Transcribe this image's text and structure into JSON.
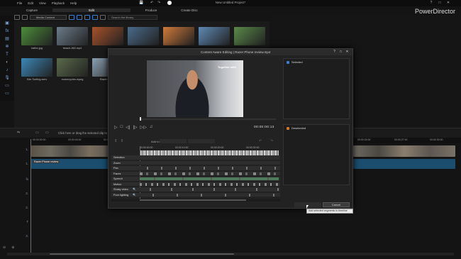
{
  "menu": {
    "items": [
      "File",
      "Edit",
      "View",
      "Playback",
      "Help"
    ]
  },
  "title": "New Untitled Project*",
  "window_controls": [
    "?",
    "—",
    "□",
    "✕"
  ],
  "mode_tabs": [
    {
      "label": "Capture"
    },
    {
      "label": "Edit",
      "active": true
    },
    {
      "label": "Produce"
    },
    {
      "label": "Create Disc"
    }
  ],
  "brand": "PowerDirector",
  "media_toolbar": {
    "select_value": "Media Content",
    "search_placeholder": "Search the library"
  },
  "media_items": [
    {
      "name": "bafbn.jpg",
      "color": "#4c8e3a"
    },
    {
      "name": "beach-360.mp4",
      "color": "#6b7c8a"
    },
    {
      "name": "",
      "color": "#a7522a"
    },
    {
      "name": "",
      "color": "#4a6a8a"
    },
    {
      "name": "",
      "color": "#d07a3a"
    },
    {
      "name": "",
      "color": "#5f89b4"
    },
    {
      "name": "",
      "color": "#5a8a4a"
    },
    {
      "name": "Kite Surfing.wmv",
      "color": "#3c88b8"
    },
    {
      "name": "motorcycles.mpeg",
      "color": "#5a6a4a"
    },
    {
      "name": "Razer Phone",
      "color": "#8aa0b0"
    }
  ],
  "timeline": {
    "hint": "Click here or drag the selected clip to a",
    "ruler": [
      "00:00:00:00",
      "00:00:03:00",
      "00:00:06:00",
      "00:00:09:00",
      "00:00:12:00",
      "00:00:15:00",
      "00:00:18:00",
      "00:00:21:00",
      "00:00:24:00",
      "00:00:27:00",
      "00:00:30:00",
      "00:00:33:00"
    ],
    "audio_clip_label": "Razer Phone review",
    "tracks": [
      "1.",
      "1.",
      "fx",
      "2.",
      "2.",
      "T",
      "3."
    ]
  },
  "dialog": {
    "title": "Content Aware Editing  |  Razer Phone review.mp4",
    "overlay_text": "Together with",
    "timecode": "00:00:00:13",
    "add_to_label": "Add to:",
    "ruler": [
      "00:00:00:00",
      "00:00:10:00",
      "00:00:20:00",
      "00:00:30:00"
    ],
    "rows": [
      {
        "label": "Selection",
        "color": "#3a3a3a"
      },
      {
        "label": "Zoom",
        "color": "#7a7a7a"
      },
      {
        "label": "Pan",
        "color": "#7a7a7a"
      },
      {
        "label": "Faces",
        "color": "#888"
      },
      {
        "label": "Speech",
        "color": "#4d7a5a"
      },
      {
        "label": "Motion",
        "color": "#888"
      },
      {
        "label": "Shaky video",
        "color": "#888"
      },
      {
        "label": "Poor lighting",
        "color": "#888"
      }
    ],
    "selected_panel": "Selected",
    "deselected_panel": "Deselected",
    "selected_color": "#3e7ec7",
    "deselected_color": "#d0772a",
    "ok_label": "",
    "cancel_label": "Cancel",
    "tooltip": "Add selected segments to timeline"
  }
}
